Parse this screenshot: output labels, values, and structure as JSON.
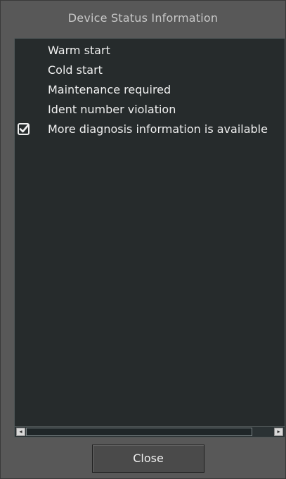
{
  "dialog": {
    "title": "Device Status Information"
  },
  "status_list": {
    "items": [
      {
        "label": "Warm start",
        "checked": false
      },
      {
        "label": "Cold start",
        "checked": false
      },
      {
        "label": "Maintenance required",
        "checked": false
      },
      {
        "label": "Ident number violation",
        "checked": false
      },
      {
        "label": "More diagnosis information is available",
        "checked": true
      }
    ]
  },
  "scrollbar": {
    "left_arrow": "◂",
    "right_arrow": "▸"
  },
  "buttons": {
    "close_label": "Close"
  },
  "colors": {
    "dialog_bg": "#585858",
    "panel_bg": "#262b2c",
    "text": "#f0f0f0"
  }
}
